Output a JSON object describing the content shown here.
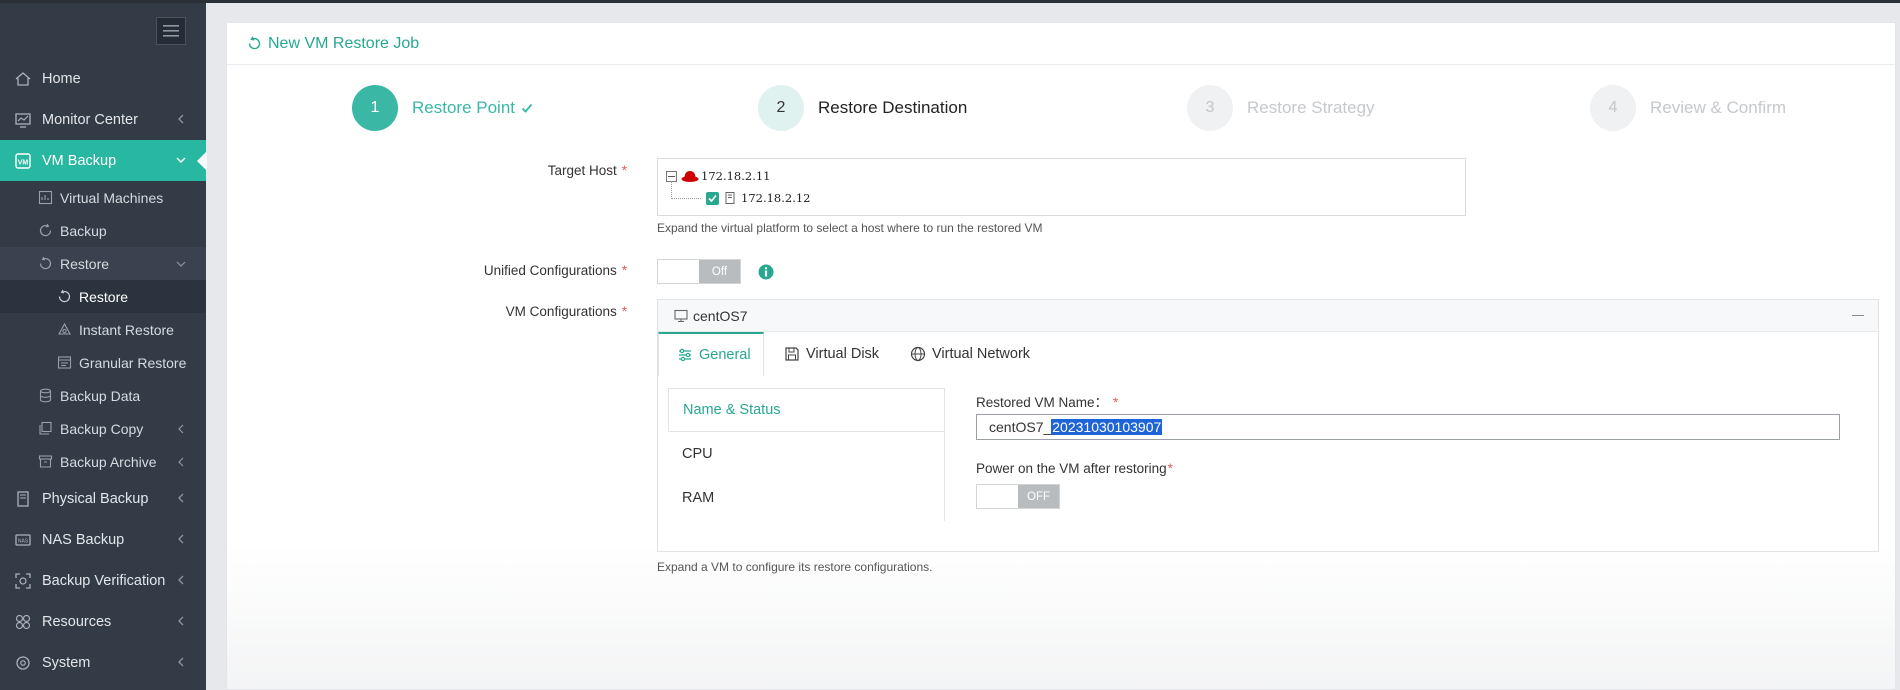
{
  "sidebar": {
    "items": [
      {
        "label": "Home"
      },
      {
        "label": "Monitor Center"
      },
      {
        "label": "VM Backup"
      }
    ],
    "vm_backup_sub": [
      {
        "label": "Virtual Machines"
      },
      {
        "label": "Backup"
      },
      {
        "label": "Restore"
      }
    ],
    "restore_sub": [
      {
        "label": "Restore"
      },
      {
        "label": "Instant Restore"
      },
      {
        "label": "Granular Restore"
      }
    ],
    "vm_backup_sub2": [
      {
        "label": "Backup Data"
      },
      {
        "label": "Backup Copy"
      },
      {
        "label": "Backup Archive"
      }
    ],
    "bottom_items": [
      {
        "label": "Physical Backup"
      },
      {
        "label": "NAS Backup"
      },
      {
        "label": "Backup Verification"
      },
      {
        "label": "Resources"
      },
      {
        "label": "System"
      }
    ]
  },
  "page": {
    "title": "New VM Restore Job"
  },
  "steps": [
    {
      "num": "1",
      "label": "Restore Point",
      "state": "done"
    },
    {
      "num": "2",
      "label": "Restore Destination",
      "state": "current"
    },
    {
      "num": "3",
      "label": "Restore Strategy",
      "state": "todo"
    },
    {
      "num": "4",
      "label": "Review & Confirm",
      "state": "todo"
    }
  ],
  "form": {
    "target_host_label": "Target Host",
    "required_mark": "*",
    "tree": {
      "parent": "172.18.2.11",
      "child": "172.18.2.12",
      "child_checked": true
    },
    "target_host_hint": "Expand the virtual platform to select a host where to run the restored VM",
    "unified_label": "Unified Configurations",
    "unified_state": "Off",
    "vm_config_label": "VM Configurations",
    "vm_name": "centOS7",
    "tabs": [
      {
        "label": "General",
        "icon": "sliders-icon"
      },
      {
        "label": "Virtual Disk",
        "icon": "disk-icon"
      },
      {
        "label": "Virtual Network",
        "icon": "globe-icon"
      }
    ],
    "side_list": [
      "Name & Status",
      "CPU",
      "RAM"
    ],
    "restored_name_label": "Restored VM Name：",
    "restored_name_prefix": "centOS7_",
    "restored_name_selected": "20231030103907",
    "power_label": "Power on the VM after restoring",
    "power_state": "OFF",
    "footer_hint": "Expand a VM to configure its restore configurations."
  },
  "colors": {
    "accent": "#28b7a0",
    "sidebar_bg": "#333b47",
    "required": "#e35d5d"
  }
}
